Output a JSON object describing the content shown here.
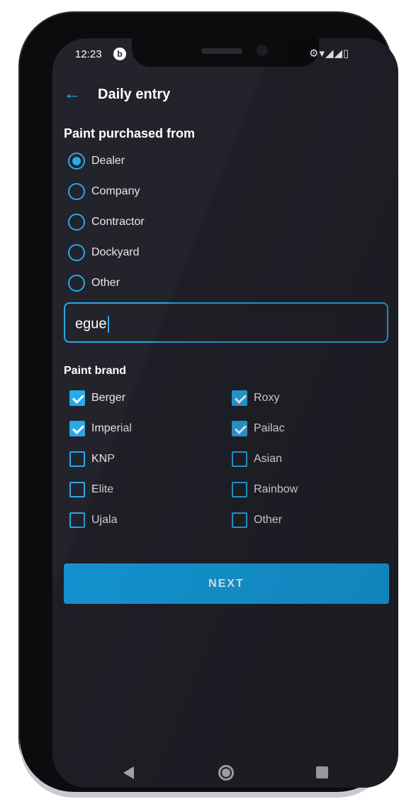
{
  "status_bar": {
    "time": "12:23",
    "right_icons": "⚙▾◢◢▯"
  },
  "app_bar": {
    "back_icon": "arrow-left-icon",
    "title": "Daily entry"
  },
  "purchase_section": {
    "title": "Paint purchased from",
    "options": [
      {
        "label": "Dealer",
        "selected": true
      },
      {
        "label": "Company",
        "selected": false
      },
      {
        "label": "Contractor",
        "selected": false
      },
      {
        "label": "Dockyard",
        "selected": false
      },
      {
        "label": "Other",
        "selected": false
      }
    ],
    "other_input_value": "egue"
  },
  "brand_section": {
    "title": "Paint brand",
    "left": [
      {
        "label": "Berger",
        "checked": true
      },
      {
        "label": "Imperial",
        "checked": true
      },
      {
        "label": "KNP",
        "checked": false
      },
      {
        "label": "Elite",
        "checked": false
      },
      {
        "label": "Ujala",
        "checked": false
      }
    ],
    "right": [
      {
        "label": "Roxy",
        "checked": true
      },
      {
        "label": "Pailac",
        "checked": true
      },
      {
        "label": "Asian",
        "checked": false
      },
      {
        "label": "Rainbow",
        "checked": false
      },
      {
        "label": "Other",
        "checked": false
      }
    ]
  },
  "next_button": {
    "label": "NEXT"
  },
  "colors": {
    "accent": "#29a8ea",
    "button": "#16a5ea",
    "background": "#22232b"
  }
}
